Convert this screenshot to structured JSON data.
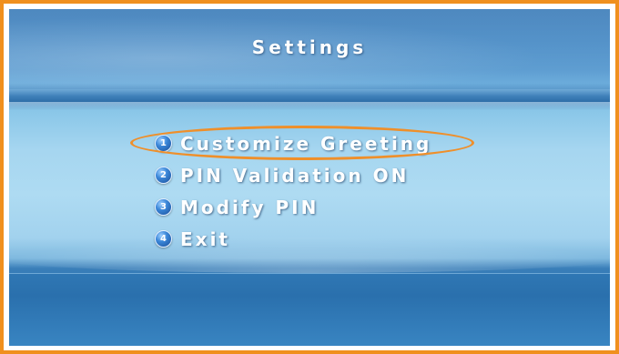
{
  "screen": {
    "title": "Settings"
  },
  "menu": {
    "items": [
      {
        "number": "1",
        "label": "Customize Greeting",
        "highlighted": true
      },
      {
        "number": "2",
        "label": "PIN Validation ON",
        "highlighted": false
      },
      {
        "number": "3",
        "label": "Modify PIN",
        "highlighted": false
      },
      {
        "number": "4",
        "label": "Exit",
        "highlighted": false
      }
    ]
  },
  "colors": {
    "frame_border": "#f0901e",
    "highlight_ring": "#ef8f2a",
    "background_blue": "#a6d6f0",
    "text": "#ffffff"
  }
}
